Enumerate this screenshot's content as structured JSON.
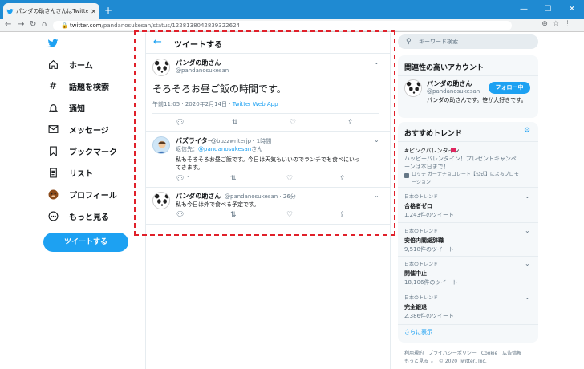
{
  "browser": {
    "tab_title": "パンダの助さんさんはTwitterを使ってい",
    "url_host": "twitter.com",
    "url_path": "/pandanosukesan/status/1228138042839322624"
  },
  "nav": {
    "items": [
      {
        "label": "ホーム"
      },
      {
        "label": "話題を検索"
      },
      {
        "label": "通知"
      },
      {
        "label": "メッセージ"
      },
      {
        "label": "ブックマーク"
      },
      {
        "label": "リスト"
      },
      {
        "label": "プロフィール"
      },
      {
        "label": "もっと見る"
      }
    ],
    "tweet_button": "ツイートする"
  },
  "main": {
    "header_title": "ツイートする",
    "tweet": {
      "name": "パンダの助さん",
      "handle": "@pandanosukesan",
      "text": "そろそろお昼ご飯の時間です。",
      "time": "午前11:05 · 2020年2月14日 ·",
      "source": "Twitter Web App"
    },
    "replies": [
      {
        "name": "バズライター",
        "handle": "@buzzwriterjp · 1時間",
        "to_prefix": "返信先：",
        "to_handle": "@pandanosukesan",
        "to_suffix": "さん",
        "text_line1": "私もそろそろお昼ご飯です。今日は天気もいいのでランチでも食べにいっ",
        "text_line2": "てきます。",
        "reply_count": "1"
      },
      {
        "name": "パンダの助さん",
        "handle": "@pandanosukesan · 26分",
        "text": "私も今日は外で食べる予定です。"
      }
    ]
  },
  "right": {
    "search_placeholder": "キーワード検索",
    "related": {
      "title": "関連性の高いアカウント",
      "name": "パンダの助さん",
      "handle": "@pandanosukesan",
      "bio": "パンダの助さんです。笹が大好きです。",
      "button": "フォロー中"
    },
    "trends": {
      "title": "おすすめトレンド",
      "promoted": {
        "name": "#ピンクバレンタイン",
        "desc1": "ハッピーバレンタイン！プレゼントキャンペ",
        "desc2": "ーンは本日まで！",
        "promo1": "ロッテ ガーナチョコレート【公式】によるプロモ",
        "promo2": "ーション"
      },
      "items": [
        {
          "category": "日本のトレンド",
          "name": "合格者ゼロ",
          "count": "1,243件のツイート"
        },
        {
          "category": "日本のトレンド",
          "name": "安倍内閣総辞職",
          "count": "9,518件のツイート"
        },
        {
          "category": "日本のトレンド",
          "name": "開催中止",
          "count": "18,106件のツイート"
        },
        {
          "category": "日本のトレンド",
          "name": "完全銀退",
          "count": "2,386件のツイート"
        }
      ],
      "more": "さらに表示"
    },
    "footer": {
      "line1": "利用規約　プライバシーポリシー　Cookie　広告情報",
      "line2": "もっと見る ⌄　© 2020 Twitter, Inc."
    }
  },
  "colors": {
    "accent": "#1da1f2",
    "highlight_border": "#e0202a",
    "titlebar": "#1f8ad2"
  }
}
